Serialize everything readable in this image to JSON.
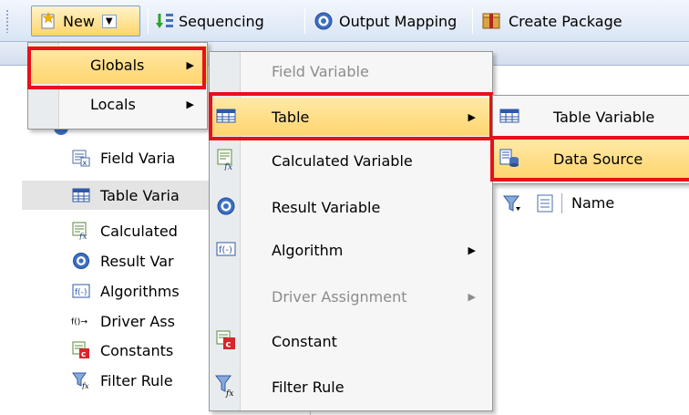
{
  "toolbar": {
    "new_label": "New",
    "sequencing_label": "Sequencing",
    "output_mapping_label": "Output Mapping",
    "create_package_label": "Create Package"
  },
  "tree": {
    "items": [
      {
        "label": "Field Varia",
        "icon": "field-variable-icon"
      },
      {
        "label": "Table Varia",
        "icon": "table-variable-icon"
      },
      {
        "label": "Calculated",
        "icon": "calculated-variable-icon"
      },
      {
        "label": "Result Var",
        "icon": "result-variable-icon"
      },
      {
        "label": "Algorithms",
        "icon": "algorithm-icon"
      },
      {
        "label": "Driver Ass",
        "icon": "driver-assignment-icon"
      },
      {
        "label": "Constants",
        "icon": "constant-icon"
      },
      {
        "label": "Filter Rule",
        "icon": "filter-rule-icon"
      }
    ]
  },
  "new_menu": {
    "items": [
      {
        "label": "Globals"
      },
      {
        "label": "Locals"
      }
    ]
  },
  "globals_menu": {
    "items": [
      {
        "label": "Field Variable",
        "disabled": true
      },
      {
        "label": "Table",
        "submenu": true
      },
      {
        "label": "Calculated Variable"
      },
      {
        "label": "Result Variable"
      },
      {
        "label": "Algorithm",
        "submenu": true
      },
      {
        "label": "Driver Assignment",
        "disabled": true,
        "submenu": true
      },
      {
        "label": "Constant"
      },
      {
        "label": "Filter Rule"
      }
    ]
  },
  "table_menu": {
    "items": [
      {
        "label": "Table Variable"
      },
      {
        "label": "Data Source"
      }
    ]
  },
  "right_pane": {
    "column_header": "Name"
  },
  "colors": {
    "highlight": "#ffd56e",
    "callout_red": "#e8101a",
    "toolbar": "#d9e4f4"
  }
}
